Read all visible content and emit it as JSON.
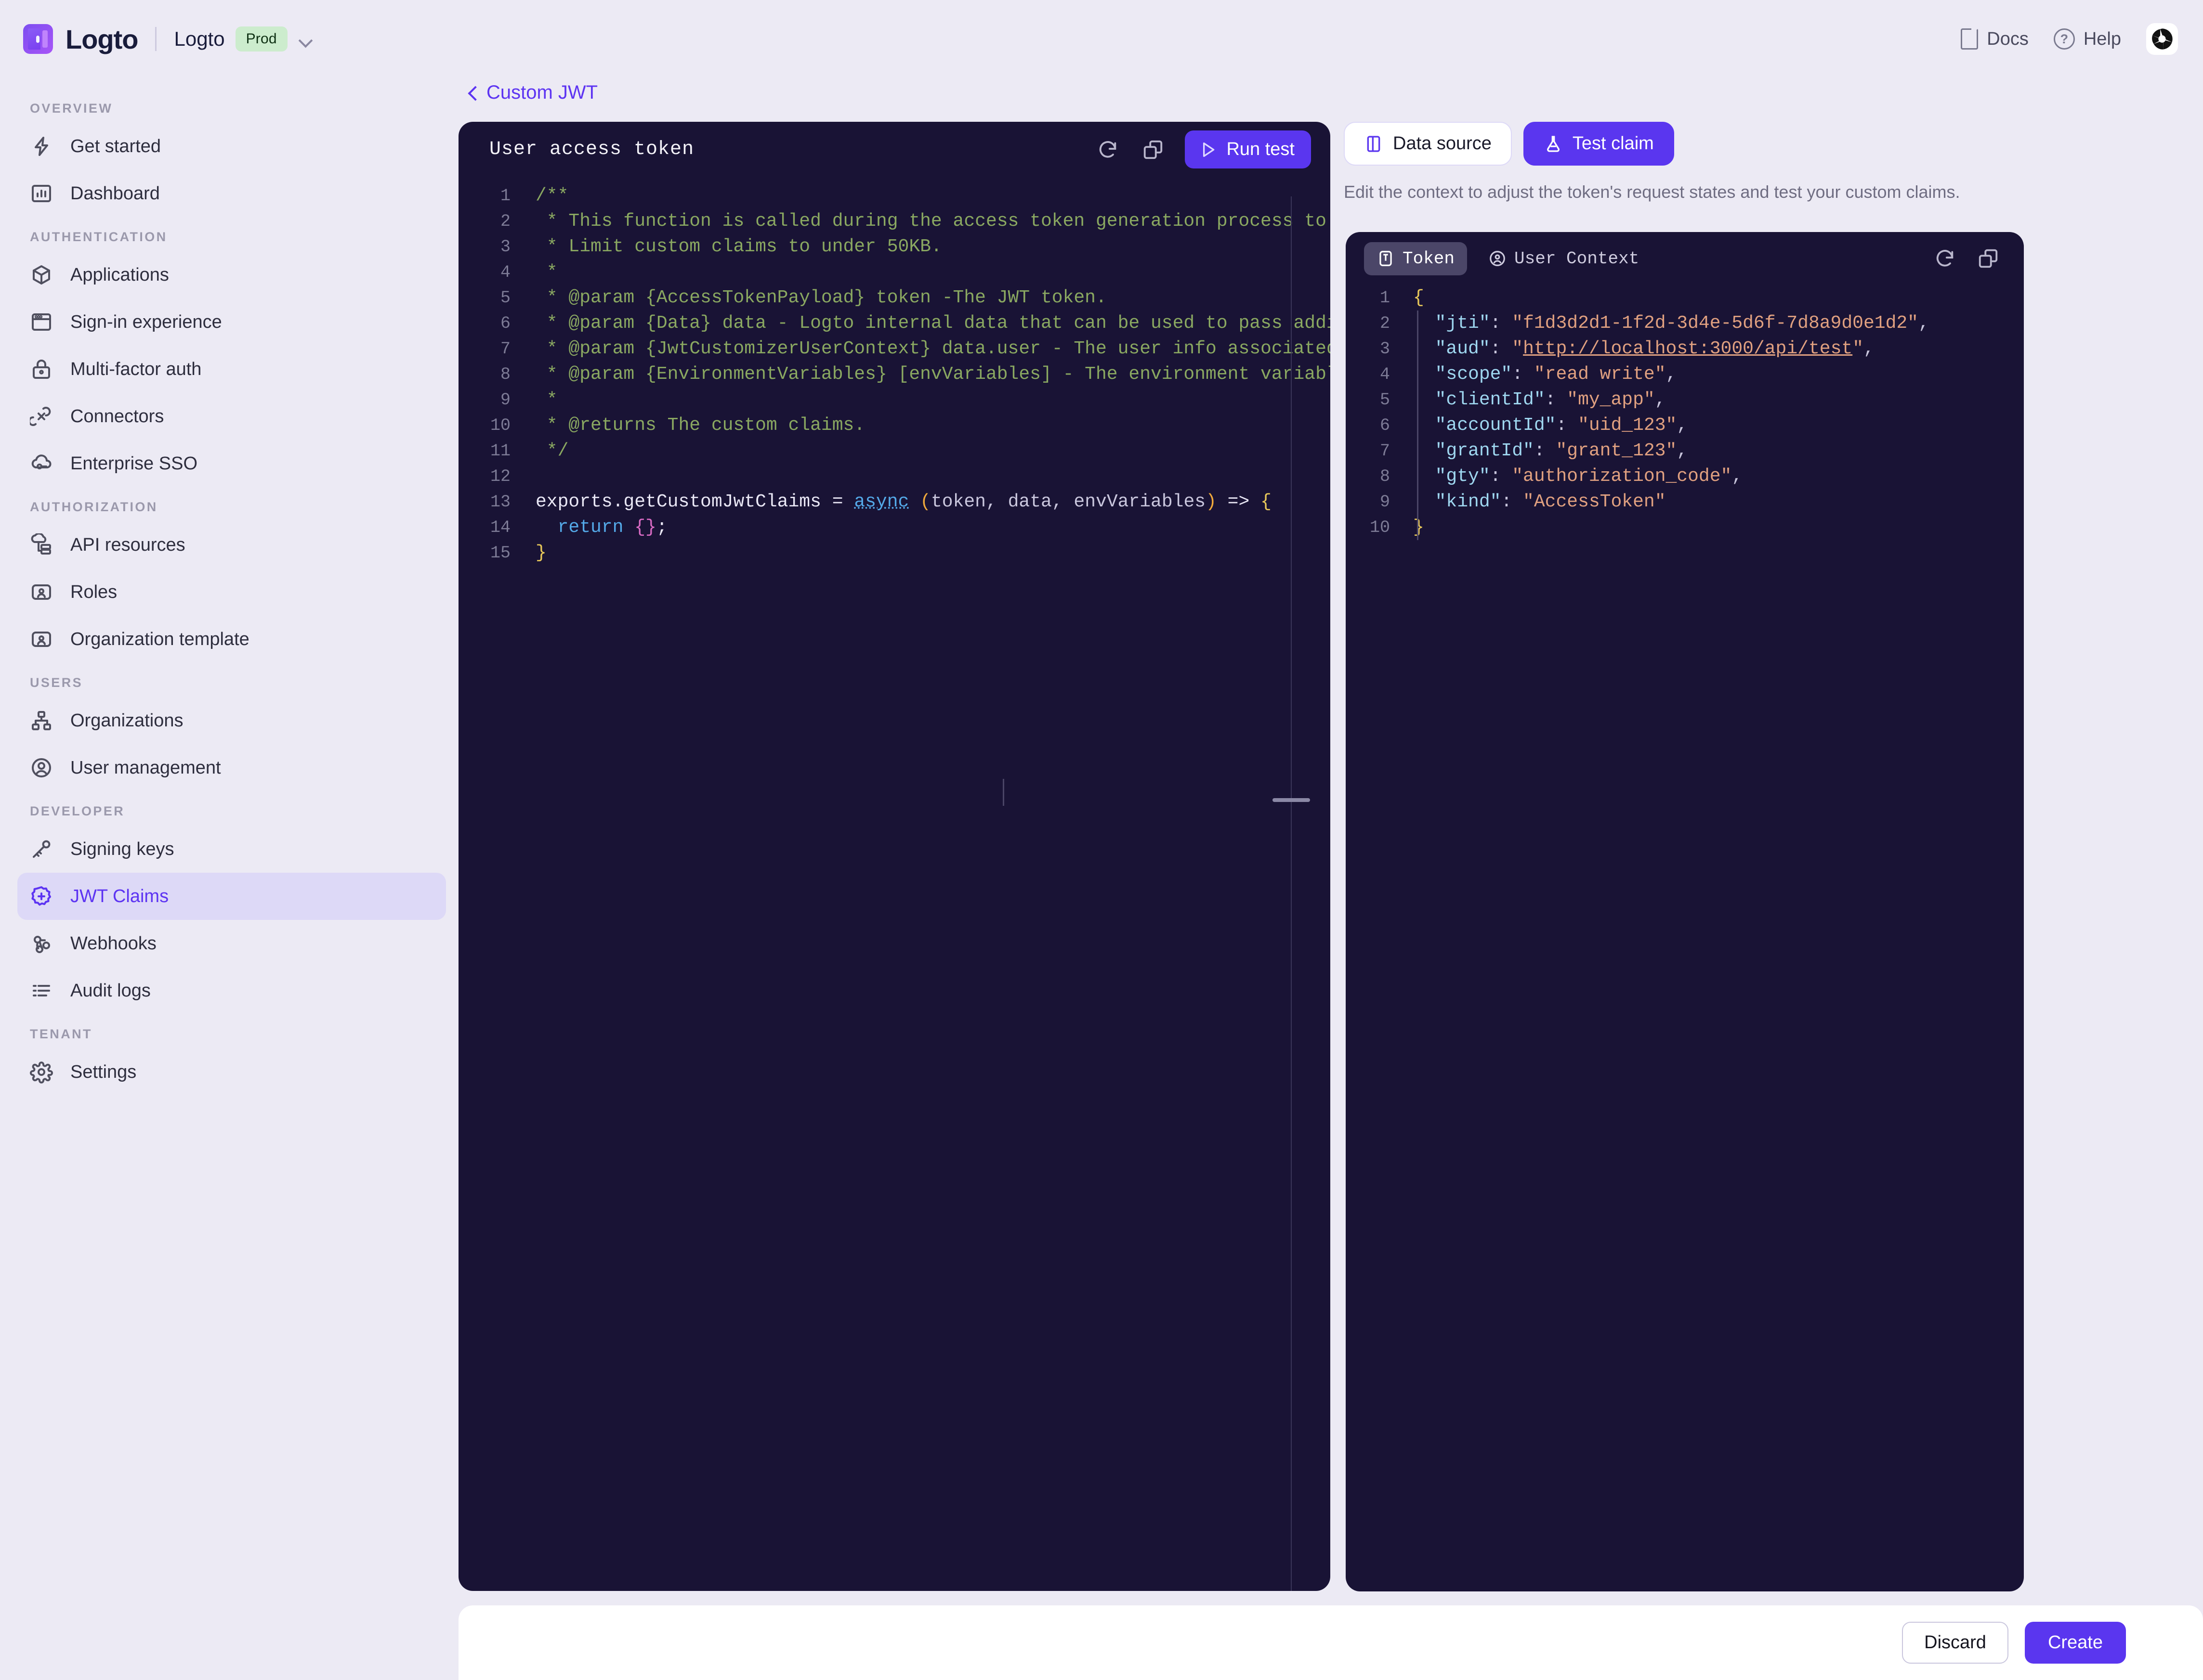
{
  "header": {
    "brand_name": "Logto",
    "tenant_name": "Logto",
    "tenant_badge": "Prod",
    "docs_label": "Docs",
    "help_label": "Help",
    "accent_color": "#5a36ef",
    "badge_color": "#cceccd"
  },
  "sidebar": {
    "groups": [
      {
        "label": "Overview",
        "items": [
          {
            "label": "Get started",
            "icon": "bolt-icon",
            "active": false
          },
          {
            "label": "Dashboard",
            "icon": "chart-icon",
            "active": false
          }
        ]
      },
      {
        "label": "Authentication",
        "items": [
          {
            "label": "Applications",
            "icon": "cube-icon",
            "active": false
          },
          {
            "label": "Sign-in experience",
            "icon": "window-icon",
            "active": false
          },
          {
            "label": "Multi-factor auth",
            "icon": "lock-icon",
            "active": false
          },
          {
            "label": "Connectors",
            "icon": "connectors-icon",
            "active": false
          },
          {
            "label": "Enterprise SSO",
            "icon": "cloud-key-icon",
            "active": false
          }
        ]
      },
      {
        "label": "Authorization",
        "items": [
          {
            "label": "API resources",
            "icon": "api-icon",
            "active": false
          },
          {
            "label": "Roles",
            "icon": "role-card-icon",
            "active": false
          },
          {
            "label": "Organization template",
            "icon": "org-template-icon",
            "active": false
          }
        ]
      },
      {
        "label": "Users",
        "items": [
          {
            "label": "Organizations",
            "icon": "sitemap-icon",
            "active": false
          },
          {
            "label": "User management",
            "icon": "user-circle-icon",
            "active": false
          }
        ]
      },
      {
        "label": "Developer",
        "items": [
          {
            "label": "Signing keys",
            "icon": "key-icon",
            "active": false
          },
          {
            "label": "JWT Claims",
            "icon": "badge-plus-icon",
            "active": true
          },
          {
            "label": "Webhooks",
            "icon": "webhook-icon",
            "active": false
          },
          {
            "label": "Audit logs",
            "icon": "list-icon",
            "active": false
          }
        ]
      },
      {
        "label": "Tenant",
        "items": [
          {
            "label": "Settings",
            "icon": "gear-icon",
            "active": false
          }
        ]
      }
    ]
  },
  "breadcrumb": {
    "label": "Custom JWT"
  },
  "editor": {
    "title": "User access token",
    "run_label": "Run test",
    "lines": [
      {
        "n": "1",
        "parts": [
          {
            "c": "cm",
            "t": "/**"
          }
        ]
      },
      {
        "n": "2",
        "parts": [
          {
            "c": "cm",
            "t": " * This function is called during the access token generation process to get cu"
          }
        ]
      },
      {
        "n": "3",
        "parts": [
          {
            "c": "cm",
            "t": " * Limit custom claims to under 50KB."
          }
        ]
      },
      {
        "n": "4",
        "parts": [
          {
            "c": "cm",
            "t": " *"
          }
        ]
      },
      {
        "n": "5",
        "parts": [
          {
            "c": "cm",
            "t": " * @param {AccessTokenPayload} token -The JWT token."
          }
        ]
      },
      {
        "n": "6",
        "parts": [
          {
            "c": "cm",
            "t": " * @param {Data} data - Logto internal data that can be used to pass additional"
          }
        ]
      },
      {
        "n": "7",
        "parts": [
          {
            "c": "cm",
            "t": " * @param {JwtCustomizerUserContext} data.user - The user info associated with"
          }
        ]
      },
      {
        "n": "8",
        "parts": [
          {
            "c": "cm",
            "t": " * @param {EnvironmentVariables} [envVariables] - The environment variables."
          }
        ]
      },
      {
        "n": "9",
        "parts": [
          {
            "c": "cm",
            "t": " *"
          }
        ]
      },
      {
        "n": "10",
        "parts": [
          {
            "c": "cm",
            "t": " * @returns The custom claims."
          }
        ]
      },
      {
        "n": "11",
        "parts": [
          {
            "c": "cm",
            "t": " */"
          }
        ]
      },
      {
        "n": "12",
        "parts": [
          {
            "c": "pl",
            "t": ""
          }
        ]
      },
      {
        "n": "13",
        "parts": [
          {
            "c": "pl",
            "t": "exports.getCustomJwtClaims = "
          },
          {
            "c": "kw underline-sq",
            "t": "async"
          },
          {
            "c": "pl",
            "t": " "
          },
          {
            "c": "pn",
            "t": "("
          },
          {
            "c": "vr",
            "t": "token, data, envVariables"
          },
          {
            "c": "pn",
            "t": ")"
          },
          {
            "c": "pl",
            "t": " => "
          },
          {
            "c": "jb",
            "t": "{"
          }
        ]
      },
      {
        "n": "14",
        "parts": [
          {
            "c": "pl",
            "t": "  "
          },
          {
            "c": "kw",
            "t": "return"
          },
          {
            "c": "pl",
            "t": " "
          },
          {
            "c": "br",
            "t": "{}"
          },
          {
            "c": "pl",
            "t": ";"
          }
        ]
      },
      {
        "n": "15",
        "parts": [
          {
            "c": "jb",
            "t": "}"
          }
        ]
      }
    ]
  },
  "right_panel": {
    "tabs": [
      {
        "label": "Data source",
        "icon": "panel-icon",
        "active": false
      },
      {
        "label": "Test claim",
        "icon": "flask-icon",
        "active": true
      }
    ],
    "description": "Edit the context to adjust the token's request states and test your custom claims.",
    "context_tabs": [
      {
        "label": "Token",
        "icon": "token-icon",
        "active": true
      },
      {
        "label": "User Context",
        "icon": "user-icon",
        "active": false
      }
    ],
    "json_lines": [
      {
        "n": "1",
        "parts": [
          {
            "c": "jb",
            "t": "{"
          }
        ]
      },
      {
        "n": "2",
        "parts": [
          {
            "c": "jp",
            "t": "  "
          },
          {
            "c": "jk",
            "t": "\"jti\""
          },
          {
            "c": "jp",
            "t": ": "
          },
          {
            "c": "jv",
            "t": "\"f1d3d2d1-1f2d-3d4e-5d6f-7d8a9d0e1d2\""
          },
          {
            "c": "jp",
            "t": ","
          }
        ]
      },
      {
        "n": "3",
        "parts": [
          {
            "c": "jp",
            "t": "  "
          },
          {
            "c": "jk",
            "t": "\"aud\""
          },
          {
            "c": "jp",
            "t": ": "
          },
          {
            "c": "jv",
            "t": "\""
          },
          {
            "c": "jlink",
            "t": "http://localhost:3000/api/test"
          },
          {
            "c": "jv",
            "t": "\""
          },
          {
            "c": "jp",
            "t": ","
          }
        ]
      },
      {
        "n": "4",
        "parts": [
          {
            "c": "jp",
            "t": "  "
          },
          {
            "c": "jk",
            "t": "\"scope\""
          },
          {
            "c": "jp",
            "t": ": "
          },
          {
            "c": "jv",
            "t": "\"read write\""
          },
          {
            "c": "jp",
            "t": ","
          }
        ]
      },
      {
        "n": "5",
        "parts": [
          {
            "c": "jp",
            "t": "  "
          },
          {
            "c": "jk",
            "t": "\"clientId\""
          },
          {
            "c": "jp",
            "t": ": "
          },
          {
            "c": "jv",
            "t": "\"my_app\""
          },
          {
            "c": "jp",
            "t": ","
          }
        ]
      },
      {
        "n": "6",
        "parts": [
          {
            "c": "jp",
            "t": "  "
          },
          {
            "c": "jk",
            "t": "\"accountId\""
          },
          {
            "c": "jp",
            "t": ": "
          },
          {
            "c": "jv",
            "t": "\"uid_123\""
          },
          {
            "c": "jp",
            "t": ","
          }
        ]
      },
      {
        "n": "7",
        "parts": [
          {
            "c": "jp",
            "t": "  "
          },
          {
            "c": "jk",
            "t": "\"grantId\""
          },
          {
            "c": "jp",
            "t": ": "
          },
          {
            "c": "jv",
            "t": "\"grant_123\""
          },
          {
            "c": "jp",
            "t": ","
          }
        ]
      },
      {
        "n": "8",
        "parts": [
          {
            "c": "jp",
            "t": "  "
          },
          {
            "c": "jk",
            "t": "\"gty\""
          },
          {
            "c": "jp",
            "t": ": "
          },
          {
            "c": "jv",
            "t": "\"authorization_code\""
          },
          {
            "c": "jp",
            "t": ","
          }
        ]
      },
      {
        "n": "9",
        "parts": [
          {
            "c": "jp",
            "t": "  "
          },
          {
            "c": "jk",
            "t": "\"kind\""
          },
          {
            "c": "jp",
            "t": ": "
          },
          {
            "c": "jv",
            "t": "\"AccessToken\""
          }
        ]
      },
      {
        "n": "10",
        "parts": [
          {
            "c": "jb",
            "t": "}"
          }
        ]
      }
    ]
  },
  "footer": {
    "discard_label": "Discard",
    "create_label": "Create"
  }
}
